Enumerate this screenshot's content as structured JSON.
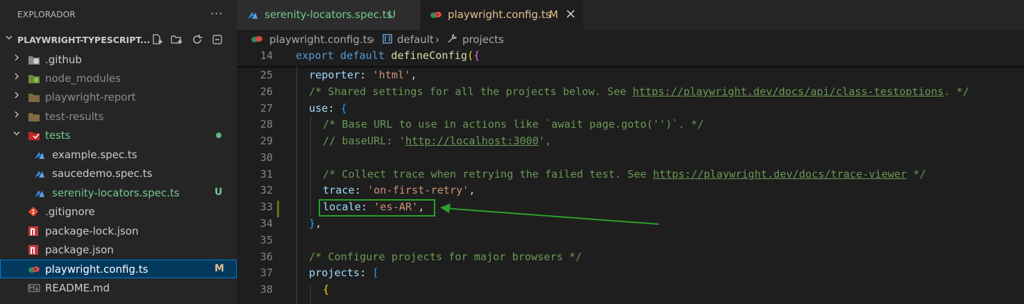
{
  "explorer": {
    "title": "EXPLORADOR",
    "more_icon": "ellipsis-icon",
    "project": {
      "name": "PLAYWRIGHT-TYPESCRIPT...",
      "actions": [
        "new-file-icon",
        "new-folder-icon",
        "refresh-icon",
        "collapse-all-icon"
      ]
    },
    "items": [
      {
        "label": ".github",
        "icon": "github-folder-icon",
        "expandable": true,
        "color": "#cccccc"
      },
      {
        "label": "node_modules",
        "icon": "node-folder-icon",
        "expandable": true,
        "color": "#8c8c8c"
      },
      {
        "label": "playwright-report",
        "icon": "folder-icon",
        "expandable": true,
        "color": "#8c8c8c"
      },
      {
        "label": "test-results",
        "icon": "folder-icon",
        "expandable": true,
        "color": "#8c8c8c"
      },
      {
        "label": "tests",
        "icon": "test-folder-icon",
        "expandable": true,
        "expanded": true,
        "color": "#73c991"
      },
      {
        "label": "example.spec.ts",
        "icon": "playwright-test-icon",
        "color": "#cccccc"
      },
      {
        "label": "saucedemo.spec.ts",
        "icon": "playwright-test-icon",
        "color": "#cccccc"
      },
      {
        "label": "serenity-locators.spec.ts",
        "icon": "playwright-test-icon",
        "color": "#73c991",
        "badge": "U"
      },
      {
        "label": ".gitignore",
        "icon": "git-icon",
        "color": "#cccccc"
      },
      {
        "label": "package-lock.json",
        "icon": "npm-icon",
        "color": "#cccccc"
      },
      {
        "label": "package.json",
        "icon": "npm-icon",
        "color": "#cccccc"
      },
      {
        "label": "playwright.config.ts",
        "icon": "playwright-config-icon",
        "color": "#e2c08d",
        "badge": "M",
        "selected": true
      },
      {
        "label": "README.md",
        "icon": "markdown-icon",
        "color": "#cccccc"
      }
    ]
  },
  "tabs": [
    {
      "label": "serenity-locators.spec.ts",
      "badge": "U",
      "icon": "playwright-test-icon",
      "color": "#73c991"
    },
    {
      "label": "playwright.config.ts",
      "badge": "M",
      "icon": "playwright-config-icon",
      "color": "#e2c08d",
      "active": true,
      "close_icon": "close-icon"
    }
  ],
  "breadcrumb": {
    "file": "playwright.config.ts",
    "symbol1": "default",
    "symbol2": "projects"
  },
  "code": {
    "sticky_line": "14",
    "lines": [
      "25",
      "26",
      "27",
      "28",
      "29",
      "30",
      "31",
      "32",
      "33",
      "34",
      "35",
      "36",
      "37",
      "38"
    ],
    "strings": {
      "export": "export",
      "default": "default",
      "defineConfig": "defineConfig",
      "reporter": "reporter",
      "html": "'html'",
      "comment26a": "/* Shared settings for all the projects below. See ",
      "url26": "https://playwright.dev/docs/api/class-testoptions",
      "comment26b": ". */",
      "use": "use",
      "comment28": "/* Base URL to use in actions like `await page.goto('')`. */",
      "comment29a": "// baseURL: '",
      "url29": "http://localhost:3000",
      "comment29b": "',",
      "comment31a": "/* Collect trace when retrying the failed test. See ",
      "url31": "https://playwright.dev/docs/trace-viewer",
      "comment31b": " */",
      "trace": "trace",
      "trace_val": "'on-first-retry'",
      "locale": "locale",
      "locale_val": "'es-AR'",
      "comment36": "/* Configure projects for major browsers */",
      "projects": "projects"
    }
  },
  "annotation": {
    "arrow_color": "#2aa12a"
  }
}
